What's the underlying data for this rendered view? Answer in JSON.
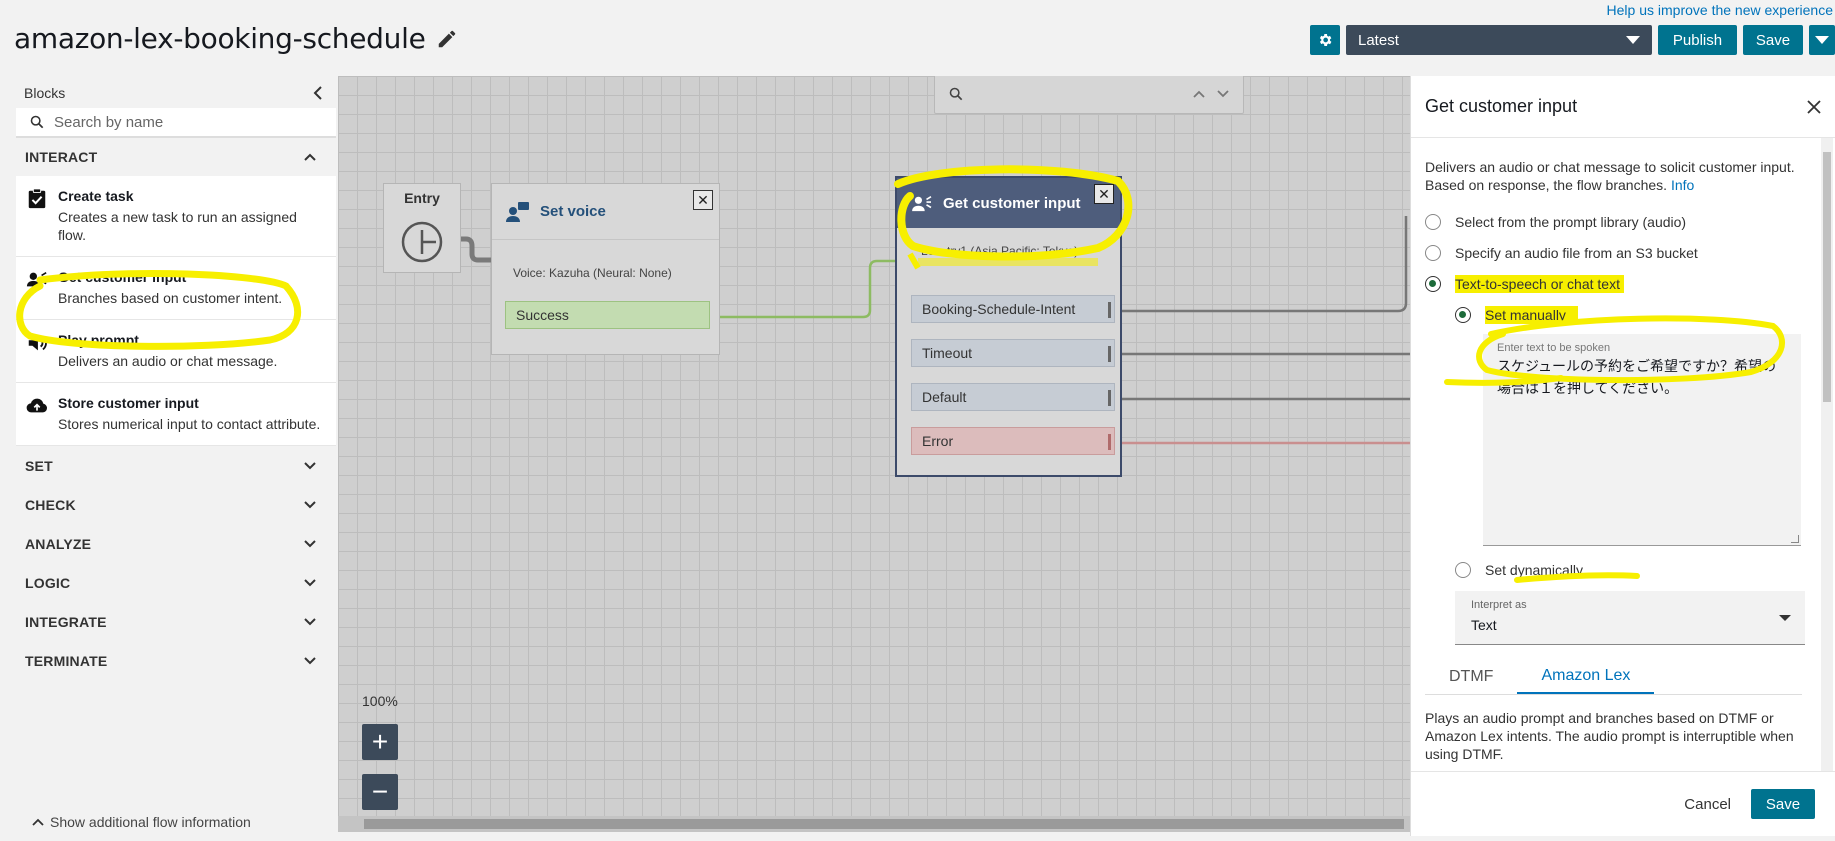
{
  "header": {
    "help_link": "Help us improve the new experience",
    "flow_title": "amazon-lex-booking-schedule",
    "version": "Latest",
    "publish_label": "Publish",
    "save_label": "Save"
  },
  "blocks_panel": {
    "title": "Blocks",
    "search_placeholder": "Search by name",
    "sections": {
      "interact": "INTERACT",
      "set": "SET",
      "check": "CHECK",
      "analyze": "ANALYZE",
      "logic": "LOGIC",
      "integrate": "INTEGRATE",
      "terminate": "TERMINATE"
    },
    "items": [
      {
        "title": "Create task",
        "desc": "Creates a new task to run an assigned flow."
      },
      {
        "title": "Get customer input",
        "desc": "Branches based on customer intent."
      },
      {
        "title": "Play prompt",
        "desc": "Delivers an audio or chat message."
      },
      {
        "title": "Store customer input",
        "desc": "Stores numerical input to contact attribute."
      }
    ],
    "show_info": "Show additional flow information"
  },
  "canvas": {
    "entry": {
      "label": "Entry"
    },
    "set_voice": {
      "title": "Set voice",
      "voice": "Voice: Kazuha (Neural: None)",
      "success": "Success"
    },
    "get_customer_input": {
      "title": "Get customer input",
      "lex": "Lex: try1 (Asia Pacific: Tokyo)",
      "branches": [
        "Booking-Schedule-Intent",
        "Timeout",
        "Default",
        "Error"
      ]
    },
    "zoom": "100%"
  },
  "properties": {
    "title": "Get customer input",
    "description": "Delivers an audio or chat message to solicit customer input. Based on response, the flow branches.",
    "info_link": "Info",
    "prompt_options": [
      "Select from the prompt library (audio)",
      "Specify an audio file from an S3 bucket",
      "Text-to-speech or chat text"
    ],
    "set_manually": "Set manually",
    "text_label": "Enter text to be spoken",
    "text_value": "スケジュールの予約をご希望ですか？希望の場合は１を押してください。",
    "set_dynamically": "Set dynamically",
    "interpret_label": "Interpret as",
    "interpret_value": "Text",
    "tabs": [
      "DTMF",
      "Amazon Lex"
    ],
    "tab_description": "Plays an audio prompt and branches based on DTMF or Amazon Lex intents. The audio prompt is interruptible when using DTMF.",
    "cancel_label": "Cancel",
    "save_label": "Save"
  },
  "colors": {
    "accent": "#00738f",
    "highlight": "#f7ef00",
    "node_header": "#4e5d7c",
    "success_branch": "#c3dcb1",
    "error_branch": "#dcbcbc"
  }
}
